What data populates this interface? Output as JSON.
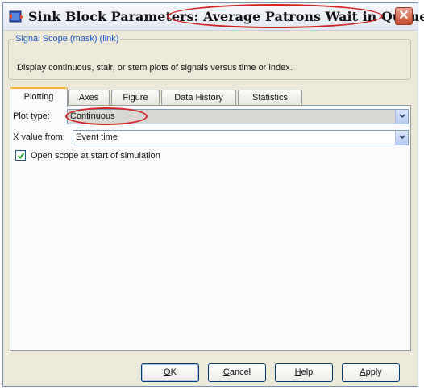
{
  "window": {
    "title": "Sink Block Parameters: Average Patrons Wait in Queue",
    "close_glyph": "✕",
    "app_icon": "simulink-block-icon"
  },
  "mask": {
    "group_label": "Signal Scope (mask) (link)",
    "description": "Display continuous, stair, or stem plots of signals versus time or index."
  },
  "tabs": [
    {
      "label": "Plotting",
      "active": true
    },
    {
      "label": "Axes",
      "active": false
    },
    {
      "label": "Figure",
      "active": false
    },
    {
      "label": "Data History",
      "active": false
    },
    {
      "label": "Statistics",
      "active": false
    }
  ],
  "plotting": {
    "plot_type_label": "Plot type:",
    "plot_type_value": "Continuous",
    "x_value_label": "X value from:",
    "x_value_value": "Event time",
    "open_scope_label": "Open scope at start of simulation",
    "open_scope_checked": true
  },
  "buttons": {
    "ok": {
      "mnemonic": "O",
      "rest": "K"
    },
    "cancel": {
      "mnemonic": "C",
      "rest": "ancel"
    },
    "help": {
      "mnemonic": "H",
      "rest": "elp"
    },
    "apply": {
      "mnemonic": "A",
      "rest": "pply"
    }
  },
  "colors": {
    "annotation_circle": "#d42323",
    "dialog_background": "#ece9d8",
    "active_tab_accent": "#f5b73a",
    "link_text": "#1a56c9"
  }
}
